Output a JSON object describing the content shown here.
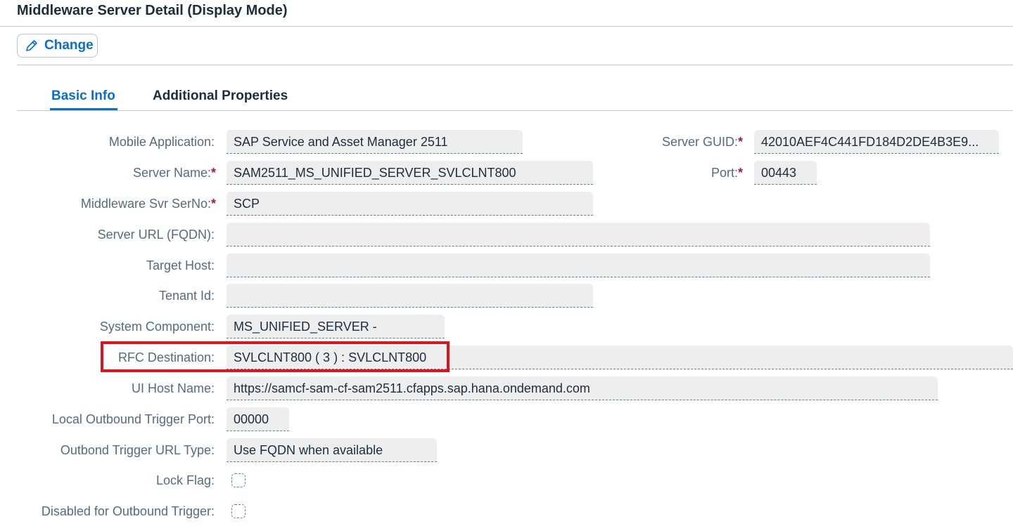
{
  "page": {
    "title": "Middleware Server Detail (Display Mode)"
  },
  "toolbar": {
    "change_label": "Change"
  },
  "tabs": [
    {
      "label": "Basic Info",
      "active": true
    },
    {
      "label": "Additional Properties",
      "active": false
    }
  ],
  "form": {
    "mobile_application": {
      "label": "Mobile Application:",
      "value": "SAP Service and Asset Manager 2511"
    },
    "server_name": {
      "label": "Server Name:",
      "value": "SAM2511_MS_UNIFIED_SERVER_SVLCLNT800"
    },
    "middleware_svr_serno": {
      "label": "Middleware Svr SerNo:",
      "value": "SCP"
    },
    "server_url": {
      "label": "Server URL (FQDN):",
      "value": ""
    },
    "target_host": {
      "label": "Target Host:",
      "value": ""
    },
    "tenant_id": {
      "label": "Tenant Id:",
      "value": ""
    },
    "system_component": {
      "label": "System Component:",
      "value": "MS_UNIFIED_SERVER -"
    },
    "rfc_destination": {
      "label": "RFC Destination:",
      "value": "SVLCLNT800 ( 3 ) : SVLCLNT800"
    },
    "ui_host_name": {
      "label": "UI Host Name:",
      "value": "https://samcf-sam-cf-sam2511.cfapps.sap.hana.ondemand.com"
    },
    "local_outbound_trigger_port": {
      "label": "Local Outbound Trigger Port:",
      "value": "00000"
    },
    "outbond_trigger_url_type": {
      "label": "Outbond Trigger URL Type:",
      "value": "Use FQDN when available"
    },
    "lock_flag": {
      "label": "Lock Flag:",
      "checked": false
    },
    "disabled_for_outbound_trigger": {
      "label": "Disabled for Outbound Trigger:",
      "checked": false
    },
    "server_guid": {
      "label": "Server GUID:",
      "value": "42010AEF4C441FD184D2DE4B3E9..."
    },
    "port": {
      "label": "Port:",
      "value": "00443"
    }
  },
  "required_marker": "*",
  "colors": {
    "accent": "#0a6ed1",
    "required": "#a0185a",
    "highlight": "#e0131b"
  }
}
